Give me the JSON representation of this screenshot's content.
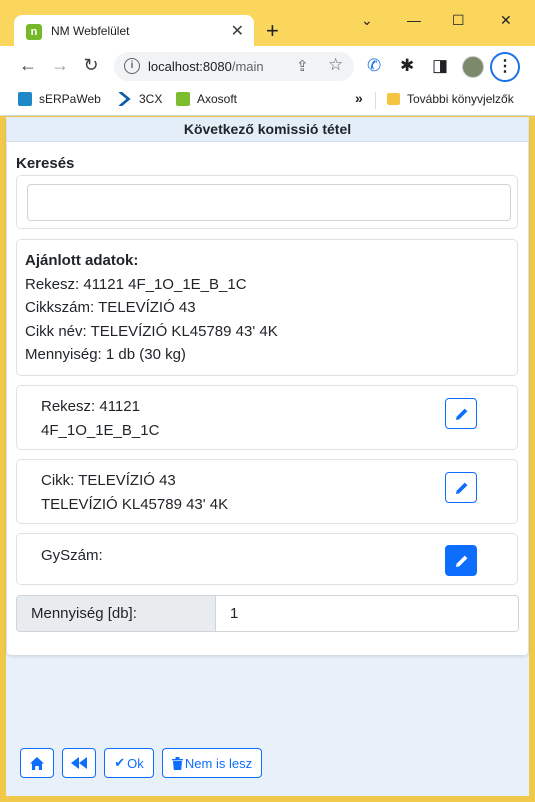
{
  "browser": {
    "tab_title": "NM Webfelület",
    "tab_favicon_letter": "n",
    "url_host": "localhost:8080",
    "url_path": "/main",
    "bookmarks": [
      "sERPaWeb",
      "3CX",
      "Axosoft"
    ],
    "bookmarks_overflow": "»",
    "other_bookmarks": "További könyvjelzők"
  },
  "page": {
    "header_title": "Következő komissió tétel",
    "search_label": "Keresés",
    "search_value": "",
    "recommended": {
      "title": "Ajánlott adatok:",
      "lines": [
        "Rekesz: 41121 4F_1O_1E_B_1C",
        "Cikkszám: TELEVÍZIÓ 43",
        "Cikk név: TELEVÍZIÓ KL45789 43' 4K",
        "Mennyiség: 1 db (30 kg)"
      ]
    },
    "rekesz": {
      "line1": "Rekesz: 41121",
      "line2": "4F_1O_1E_B_1C"
    },
    "cikk": {
      "line1": "Cikk: TELEVÍZIÓ 43",
      "line2": "TELEVÍZIÓ KL45789 43' 4K"
    },
    "gyszam": {
      "line1": "GySzám:"
    },
    "quantity": {
      "label": "Mennyiség [db]:",
      "value": "1"
    }
  },
  "footer": {
    "ok_label": "Ok",
    "cancel_label": "Nem is lesz"
  },
  "colors": {
    "primary": "#0d6efd",
    "page_bg": "#e8f1fa",
    "titlebar": "#fbd65c"
  }
}
